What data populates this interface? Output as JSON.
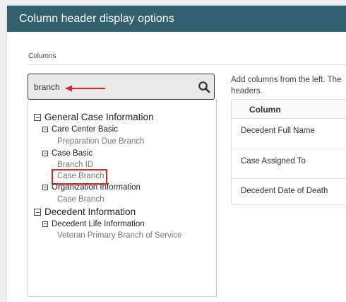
{
  "dialog": {
    "title": "Column header display options"
  },
  "columns_section": {
    "label": "Columns"
  },
  "search": {
    "value": "branch"
  },
  "tree": {
    "groups": [
      {
        "label": "General Case Information",
        "subgroups": [
          {
            "label": "Care Center Basic",
            "items": [
              "Preparation Due Branch"
            ]
          },
          {
            "label": "Case Basic",
            "items": [
              "Branch ID",
              "Case Branch"
            ]
          },
          {
            "label": "Organization Information",
            "items": [
              "Case Branch"
            ]
          }
        ]
      },
      {
        "label": "Decedent Information",
        "subgroups": [
          {
            "label": "Decedent Life Information",
            "items": [
              "Veteran Primary Branch of Service"
            ]
          }
        ]
      }
    ]
  },
  "selected_panel": {
    "intro_line1": "Add columns from the left. The",
    "intro_line2": "headers.",
    "column_header": "Column",
    "rows": [
      "Decedent Full Name",
      "Case Assigned To",
      "Decedent Date of Death"
    ]
  },
  "colors": {
    "header_bg": "#32606f",
    "annotation_red": "#e02424"
  }
}
